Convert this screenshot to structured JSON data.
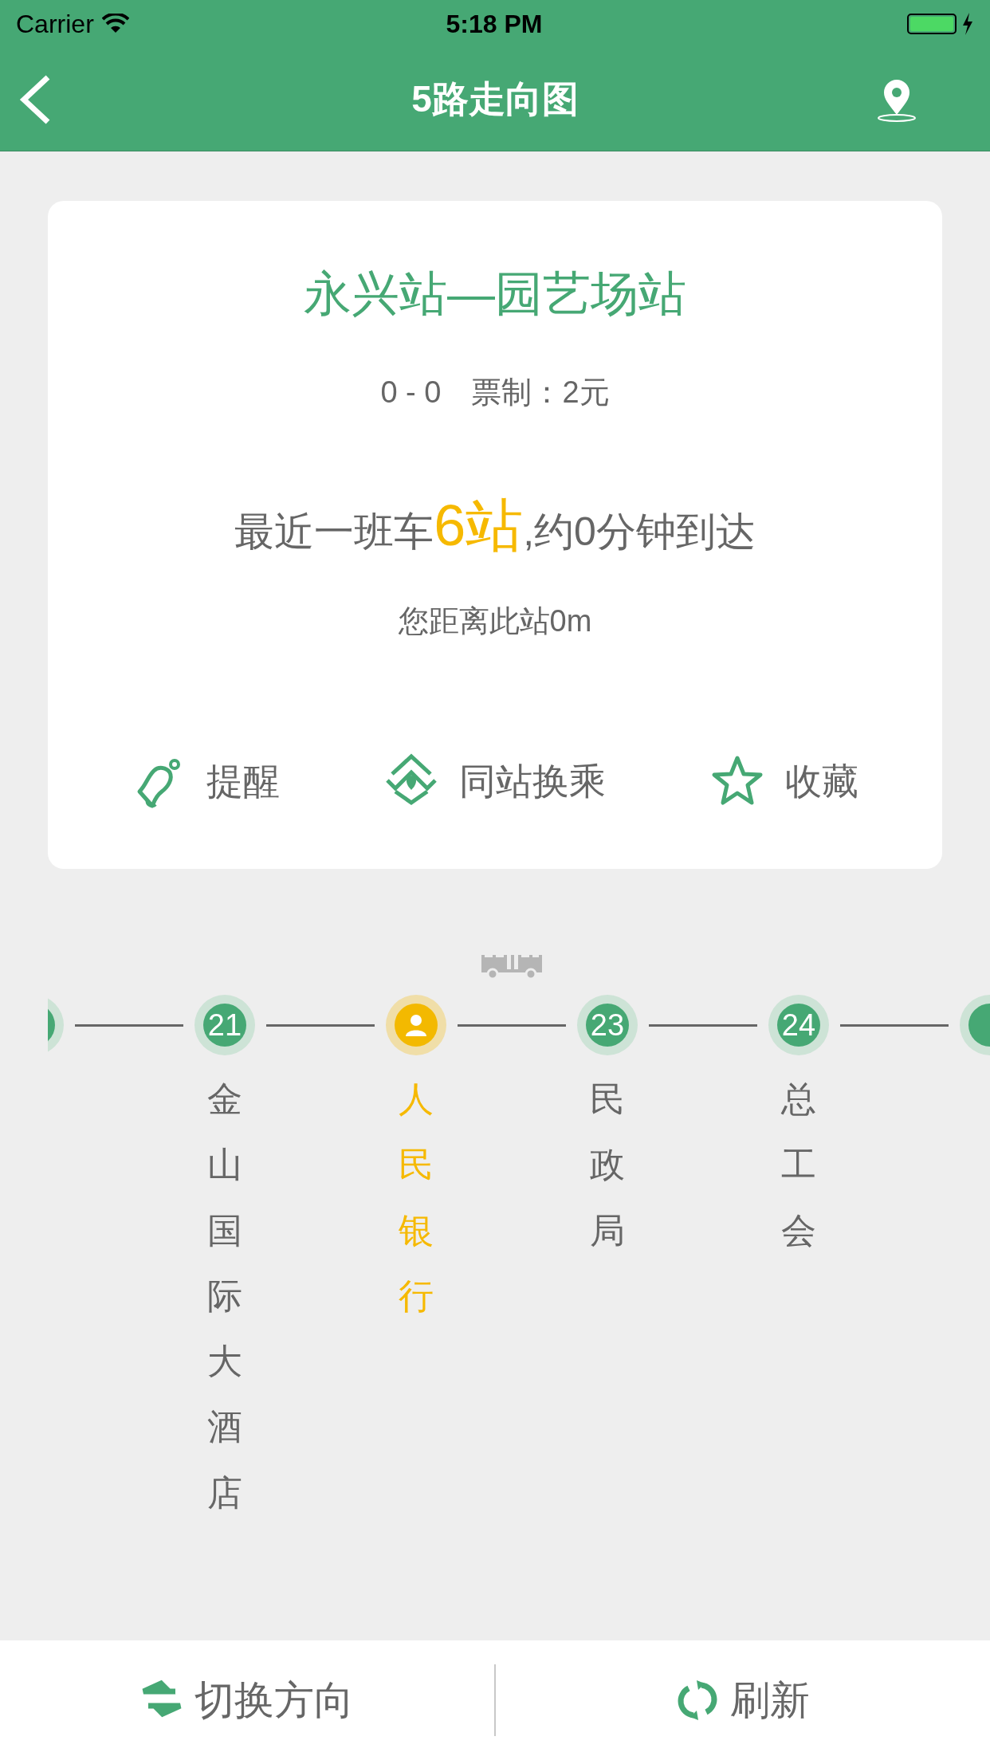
{
  "status_bar": {
    "carrier": "Carrier",
    "time": "5:18 PM"
  },
  "nav": {
    "title": "5路走向图"
  },
  "card": {
    "route": "永兴站—园艺场站",
    "info": "0 - 0　票制：2元",
    "arrival_parts": [
      {
        "text": "最近一班车",
        "highlight": false
      },
      {
        "text": "6站",
        "highlight": true
      },
      {
        "text": ",约0分钟到达",
        "highlight": false
      }
    ],
    "distance": "您距离此站0m",
    "actions": [
      {
        "kind": "bell",
        "label": "提醒"
      },
      {
        "kind": "transfer",
        "label": "同站换乘"
      },
      {
        "kind": "star",
        "label": "收藏"
      }
    ]
  },
  "stations": [
    {
      "kind": "cut",
      "bus_ahead": false
    },
    {
      "kind": "stop",
      "number": "21",
      "name": "金山国际大酒店",
      "selected": false,
      "bus_ahead": false
    },
    {
      "kind": "stop",
      "name": "人民银行",
      "selected": true,
      "bus_ahead": true
    },
    {
      "kind": "stop",
      "number": "23",
      "name": "民政局",
      "selected": false,
      "bus_ahead": false
    },
    {
      "kind": "stop",
      "number": "24",
      "name": "总工会",
      "selected": false,
      "bus_ahead": false
    },
    {
      "kind": "cut",
      "bus_ahead": false
    }
  ],
  "bottom_bar": [
    {
      "kind": "swap",
      "label": "切换方向"
    },
    {
      "kind": "refresh",
      "label": "刷新"
    }
  ]
}
